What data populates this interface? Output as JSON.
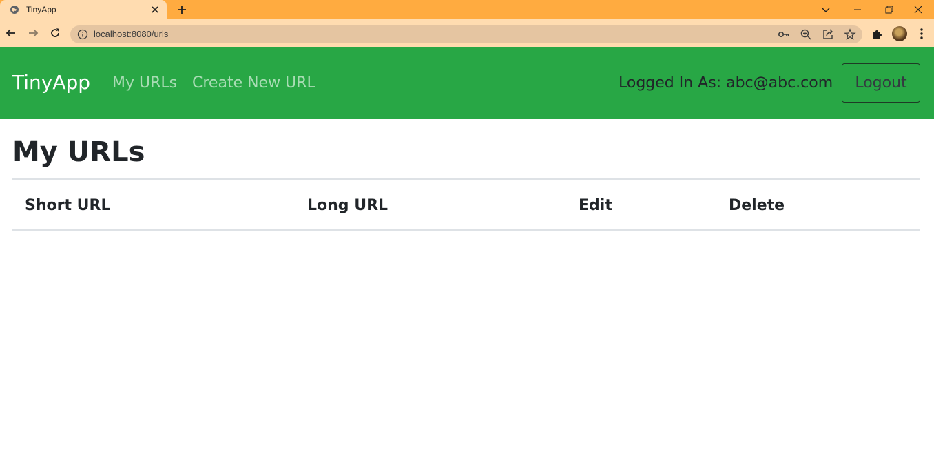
{
  "browser": {
    "tab_title": "TinyApp",
    "url": "localhost:8080/urls"
  },
  "navbar": {
    "brand": "TinyApp",
    "links": [
      {
        "label": "My URLs"
      },
      {
        "label": "Create New URL"
      }
    ],
    "logged_in": "Logged In As: abc@abc.com",
    "logout_label": "Logout"
  },
  "main": {
    "title": "My URLs",
    "columns": [
      "Short URL",
      "Long URL",
      "Edit",
      "Delete"
    ]
  },
  "colors": {
    "tabstrip": "#ffab40",
    "toolbar": "#ffdcb0",
    "navbar": "#28a745"
  }
}
